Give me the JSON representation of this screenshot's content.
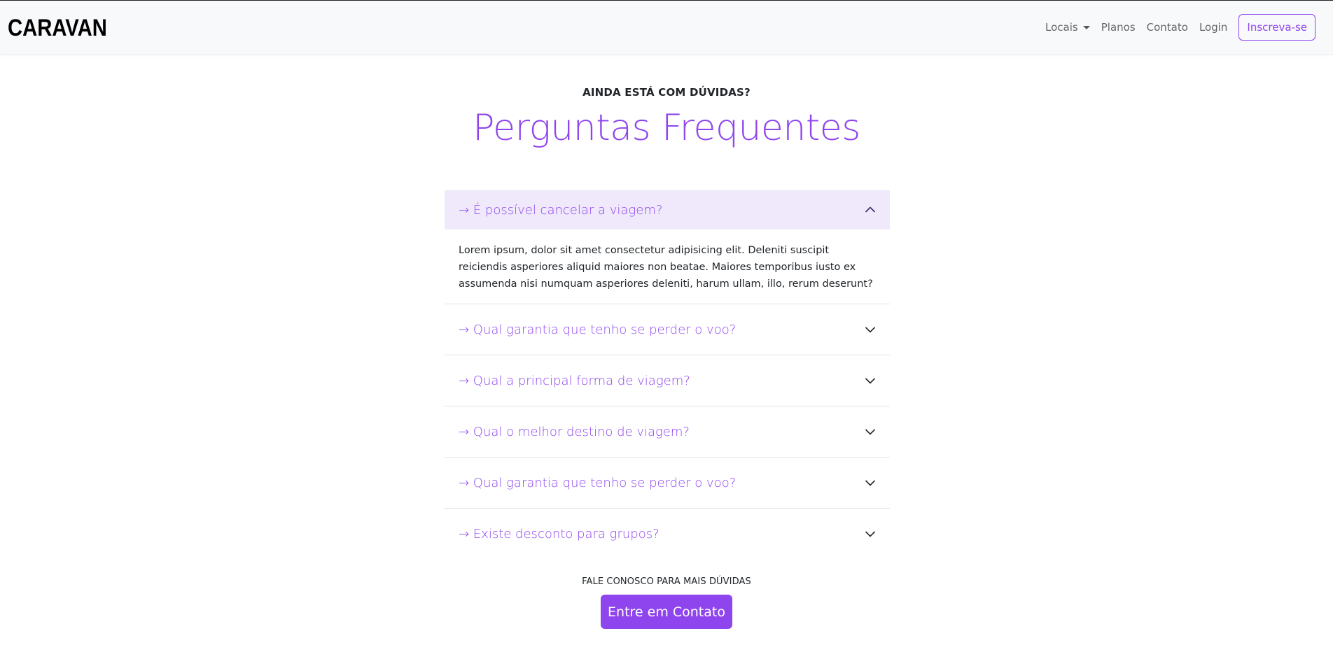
{
  "navbar": {
    "brand": "CARAVAN",
    "links": {
      "locais": "Locais",
      "planos": "Planos",
      "contato": "Contato",
      "login": "Login"
    },
    "signup_label": "Inscreva-se"
  },
  "faq": {
    "eyebrow": "AINDA ESTÁ COM DÚVIDAS?",
    "title": "Perguntas Frequentes",
    "items": [
      {
        "question": "→ É possível cancelar a viagem?",
        "answer": "Lorem ipsum, dolor sit amet consectetur adipisicing elit. Deleniti suscipit reiciendis asperiores aliquid maiores non beatae. Maiores temporibus iusto ex assumenda nisi numquam asperiores deleniti, harum ullam, illo, rerum deserunt?",
        "expanded": true
      },
      {
        "question": "→ Qual garantia que tenho se perder o voo?",
        "expanded": false
      },
      {
        "question": "→ Qual a principal forma de viagem?",
        "expanded": false
      },
      {
        "question": "→ Qual o melhor destino de viagem?",
        "expanded": false
      },
      {
        "question": "→ Qual garantia que tenho se perder o voo?",
        "expanded": false
      },
      {
        "question": "→ Existe desconto para grupos?",
        "expanded": false
      }
    ]
  },
  "contact": {
    "eyebrow": "FALE CONOSCO PARA MAIS DÚVIDAS",
    "button_label": "Entre em Contato"
  },
  "colors": {
    "accent": "#8f45ee",
    "accordion_open_bg": "#efe9fb",
    "navbar_bg": "#f8f9fa"
  },
  "icons": {
    "expanded": "chevron-up-icon",
    "collapsed": "chevron-down-icon",
    "dropdown": "caret-down-icon"
  }
}
